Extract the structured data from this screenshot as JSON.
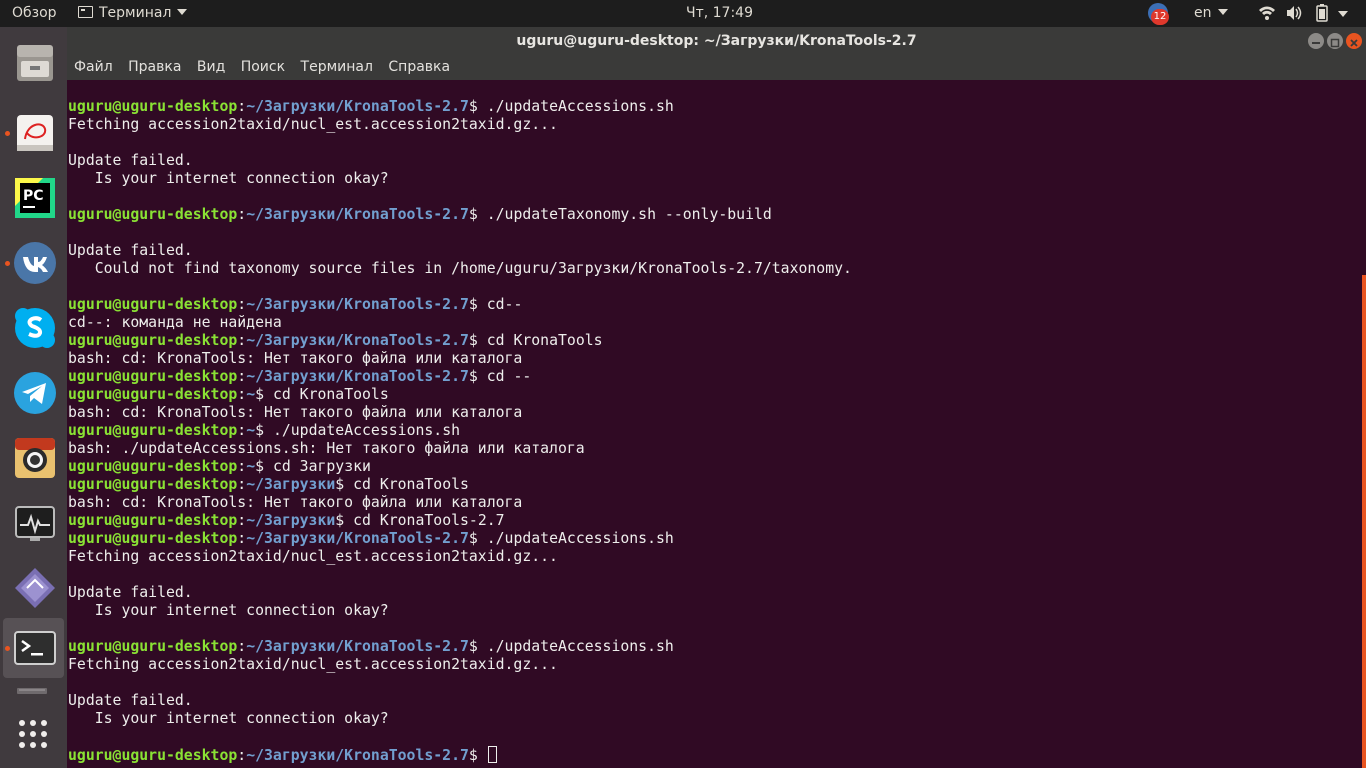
{
  "topbar": {
    "activities": "Обзор",
    "app_menu": "Терминал",
    "clock": "Чт, 17:49",
    "notifications_count": "12",
    "language": "en",
    "icons": [
      "wifi-icon",
      "volume-icon",
      "battery-icon",
      "menu-arrow-icon"
    ]
  },
  "dock": {
    "items": [
      {
        "name": "files-icon",
        "running": false
      },
      {
        "name": "document-viewer-icon",
        "running": true
      },
      {
        "name": "pycharm-icon",
        "running": false
      },
      {
        "name": "vk-icon",
        "running": true
      },
      {
        "name": "skype-icon",
        "running": false
      },
      {
        "name": "telegram-icon",
        "running": false
      },
      {
        "name": "camera-icon",
        "running": false
      },
      {
        "name": "system-monitor-icon",
        "running": false
      },
      {
        "name": "apps-diamond-icon",
        "running": false
      },
      {
        "name": "terminal-icon",
        "running": true
      },
      {
        "name": "trash-icon",
        "running": false
      },
      {
        "name": "show-applications-icon",
        "running": false
      }
    ],
    "pycharm_label": "PC"
  },
  "window": {
    "title": "uguru@uguru-desktop: ~/Загрузки/KronaTools-2.7",
    "menu": [
      "Файл",
      "Правка",
      "Вид",
      "Поиск",
      "Терминал",
      "Справка"
    ]
  },
  "colors": {
    "terminal_bg": "#300a24",
    "user_host": "#8ae234",
    "path": "#729fcf",
    "text": "#eeeeec",
    "accent": "#e95420"
  },
  "terminal": {
    "user_host": "uguru@uguru-desktop",
    "lines": [
      {
        "type": "prompt",
        "path": "~/Загрузки/KronaTools-2.7",
        "cmd": " ./updateAccessions.sh"
      },
      {
        "type": "out",
        "text": "Fetching accession2taxid/nucl_est.accession2taxid.gz..."
      },
      {
        "type": "out",
        "text": ""
      },
      {
        "type": "out",
        "text": "Update failed."
      },
      {
        "type": "out",
        "text": "   Is your internet connection okay?"
      },
      {
        "type": "out",
        "text": ""
      },
      {
        "type": "prompt",
        "path": "~/Загрузки/KronaTools-2.7",
        "cmd": " ./updateTaxonomy.sh --only-build"
      },
      {
        "type": "out",
        "text": ""
      },
      {
        "type": "out",
        "text": "Update failed."
      },
      {
        "type": "out",
        "text": "   Could not find taxonomy source files in /home/uguru/Загрузки/KronaTools-2.7/taxonomy."
      },
      {
        "type": "out",
        "text": ""
      },
      {
        "type": "prompt",
        "path": "~/Загрузки/KronaTools-2.7",
        "cmd": " cd--"
      },
      {
        "type": "out",
        "text": "cd--: команда не найдена"
      },
      {
        "type": "prompt",
        "path": "~/Загрузки/KronaTools-2.7",
        "cmd": " cd KronaTools"
      },
      {
        "type": "out",
        "text": "bash: cd: KronaTools: Нет такого файла или каталога"
      },
      {
        "type": "prompt",
        "path": "~/Загрузки/KronaTools-2.7",
        "cmd": " cd --"
      },
      {
        "type": "prompt",
        "path": "~",
        "cmd": " cd KronaTools"
      },
      {
        "type": "out",
        "text": "bash: cd: KronaTools: Нет такого файла или каталога"
      },
      {
        "type": "prompt",
        "path": "~",
        "cmd": " ./updateAccessions.sh"
      },
      {
        "type": "out",
        "text": "bash: ./updateAccessions.sh: Нет такого файла или каталога"
      },
      {
        "type": "prompt",
        "path": "~",
        "cmd": " cd Загрузки"
      },
      {
        "type": "prompt",
        "path": "~/Загрузки",
        "cmd": " cd KronaTools"
      },
      {
        "type": "out",
        "text": "bash: cd: KronaTools: Нет такого файла или каталога"
      },
      {
        "type": "prompt",
        "path": "~/Загрузки",
        "cmd": " cd KronaTools-2.7"
      },
      {
        "type": "prompt",
        "path": "~/Загрузки/KronaTools-2.7",
        "cmd": " ./updateAccessions.sh"
      },
      {
        "type": "out",
        "text": "Fetching accession2taxid/nucl_est.accession2taxid.gz..."
      },
      {
        "type": "out",
        "text": ""
      },
      {
        "type": "out",
        "text": "Update failed."
      },
      {
        "type": "out",
        "text": "   Is your internet connection okay?"
      },
      {
        "type": "out",
        "text": ""
      },
      {
        "type": "prompt",
        "path": "~/Загрузки/KronaTools-2.7",
        "cmd": " ./updateAccessions.sh"
      },
      {
        "type": "out",
        "text": "Fetching accession2taxid/nucl_est.accession2taxid.gz..."
      },
      {
        "type": "out",
        "text": ""
      },
      {
        "type": "out",
        "text": "Update failed."
      },
      {
        "type": "out",
        "text": "   Is your internet connection okay?"
      },
      {
        "type": "out",
        "text": ""
      },
      {
        "type": "prompt",
        "path": "~/Загрузки/KronaTools-2.7",
        "cmd": " ",
        "cursor": true
      }
    ]
  }
}
